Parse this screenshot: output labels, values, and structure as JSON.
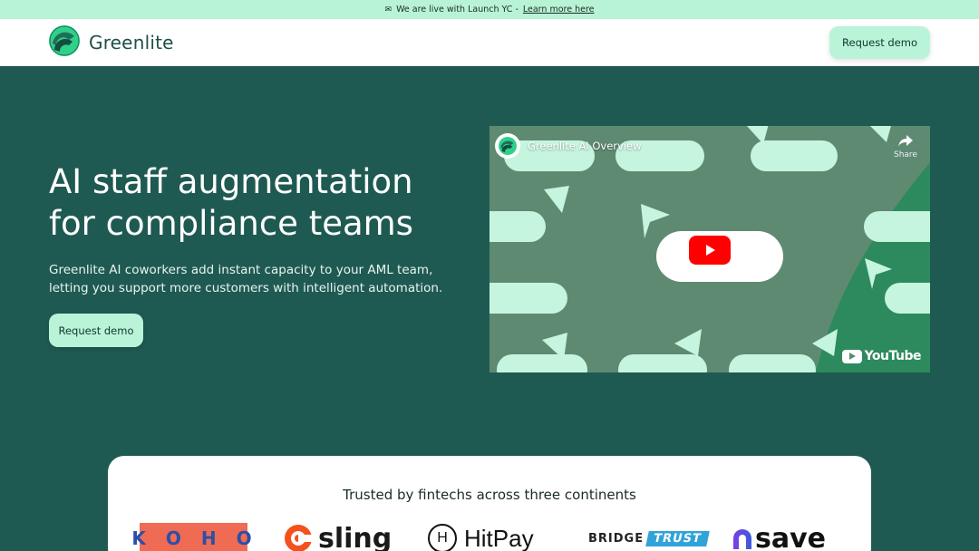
{
  "announcement": {
    "icon": "envelope-icon",
    "text": "We are live with Launch YC -",
    "link": "Learn more here"
  },
  "header": {
    "brand": "Greenlite",
    "cta": "Request demo"
  },
  "hero": {
    "title": "AI staff augmentation for compliance teams",
    "subtitle": "Greenlite AI coworkers add instant capacity to your AML team, letting you support more customers with intelligent automation.",
    "cta": "Request demo"
  },
  "video": {
    "title": "Greenlite AI Overview",
    "share_label": "Share",
    "platform": "YouTube"
  },
  "trusted": {
    "title": "Trusted by fintechs across three continents",
    "logos": [
      {
        "name": "KOHO",
        "letters": [
          "K",
          "O",
          "H",
          "O"
        ]
      },
      {
        "name": "sling"
      },
      {
        "name": "HitPay",
        "badge": "H"
      },
      {
        "name": "BRIDGE TRUST",
        "part1": "BRIDGE",
        "part2": "TRUST"
      },
      {
        "name": "save"
      }
    ]
  },
  "colors": {
    "accent": "#b9f4d9",
    "background": "#1f5a52",
    "brand_dark": "#1f4f48"
  }
}
